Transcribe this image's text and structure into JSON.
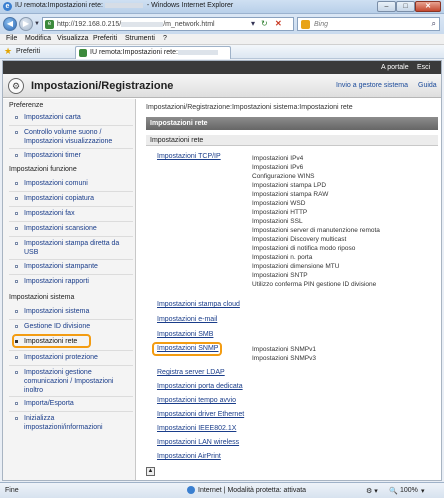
{
  "window": {
    "title_prefix": "IU remota:Impostazioni rete:",
    "title_suffix": " - Windows Internet Explorer",
    "min_label": "–",
    "max_label": "□",
    "close_label": "✕"
  },
  "address": {
    "url_prefix": "http://192.168.0.215/",
    "url_suffix": "/m_network.html",
    "search_placeholder": "Bing"
  },
  "menu": [
    "File",
    "Modifica",
    "Visualizza",
    "Preferiti",
    "Strumenti",
    "?"
  ],
  "favorites": {
    "label": "Preferiti",
    "tab_title": "IU remota:Impostazioni rete:"
  },
  "app": {
    "top_links": [
      "A portale",
      "Esci"
    ],
    "title": "Impostazioni/Registrazione",
    "header_links": [
      "Invio a gestore sistema",
      "Guida"
    ]
  },
  "sidebar": {
    "sections": [
      {
        "heading": "Preferenze",
        "items": [
          "Impostazioni carta",
          "Controllo volume suono / Impostazioni visualizzazione",
          "Impostazioni timer"
        ]
      },
      {
        "heading": "Impostazioni funzione",
        "items": [
          "Impostazioni comuni",
          "Impostazioni copiatura",
          "Impostazioni fax",
          "Impostazioni scansione",
          "Impostazioni stampa diretta da USB",
          "Impostazioni stampante",
          "Impostazioni rapporti"
        ]
      },
      {
        "heading": "Impostazioni sistema",
        "items": [
          "Impostazioni sistema",
          "Gestione ID divisione",
          "Impostazioni rete",
          "Impostazioni protezione",
          "Impostazioni gestione comunicazioni / Impostazioni inoltro",
          "Importa/Esporta",
          "Inizializza impostazioni/informazioni"
        ]
      }
    ],
    "selected": "Impostazioni rete"
  },
  "content": {
    "breadcrumb": "Impostazioni/Registrazione:Impostazioni sistema:Impostazioni rete",
    "section_title": "Impostazioni rete",
    "sub_title": "Impostazioni rete",
    "tcpip": {
      "link": "Impostazioni TCP/IP",
      "items": [
        "Impostazioni IPv4",
        "Impostazioni IPv6",
        "Configurazione WINS",
        "Impostazioni stampa LPD",
        "Impostazioni stampa RAW",
        "Impostazioni WSD",
        "Impostazioni HTTP",
        "Impostazioni SSL",
        "Impostazioni server di manutenzione remota",
        "Impostazioni Discovery multicast",
        "Impostazioni di notifica modo riposo",
        "Impostazioni n. porta",
        "Impostazioni dimensione MTU",
        "Impostazioni SNTP",
        "Utilizzo conferma PIN gestione ID divisione"
      ]
    },
    "links_mid": [
      "Impostazioni stampa cloud",
      "Impostazioni e-mail",
      "Impostazioni SMB"
    ],
    "snmp": {
      "link": "Impostazioni SNMP",
      "items": [
        "Impostazioni SNMPv1",
        "Impostazioni SNMPv3"
      ]
    },
    "links_bottom": [
      "Registra server LDAP",
      "Impostazioni porta dedicata",
      "Impostazioni tempo avvio",
      "Impostazioni driver Ethernet",
      "Impostazioni IEEE802.1X",
      "Impostazioni LAN wireless",
      "Impostazioni AirPrint"
    ]
  },
  "status": {
    "left": "Fine",
    "zone": "Internet | Modalità protetta: attivata",
    "zoom": "100%"
  }
}
